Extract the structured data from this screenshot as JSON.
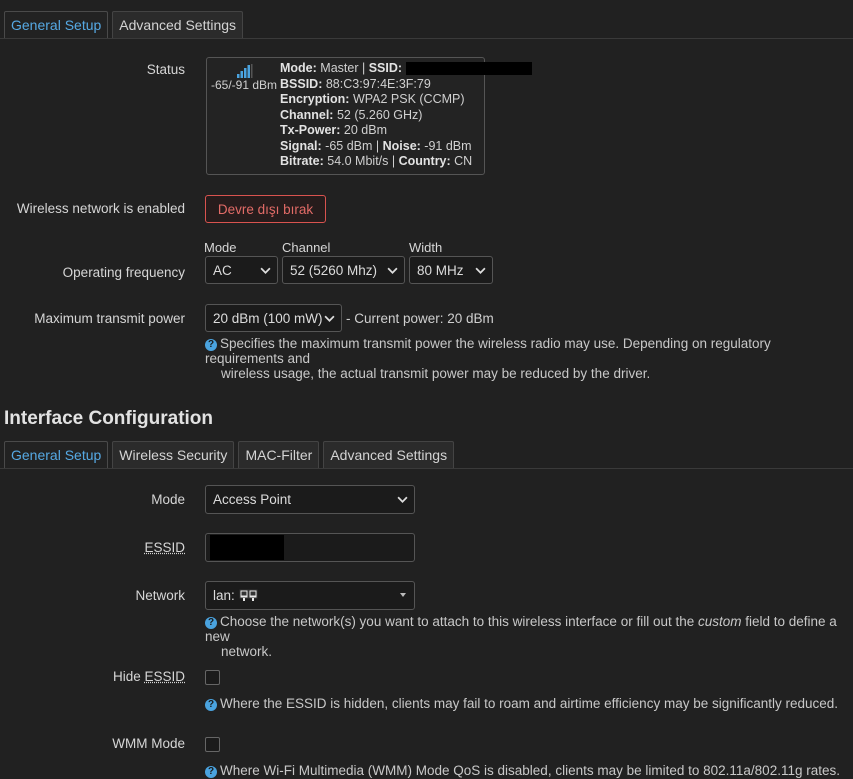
{
  "top_tabs": [
    {
      "label": "General Setup",
      "active": true
    },
    {
      "label": "Advanced Settings",
      "active": false
    }
  ],
  "status": {
    "label": "Status",
    "signal_range": "-65/-91 dBm",
    "mode_label": "Mode:",
    "mode_value": "Master",
    "ssid_label": "SSID:",
    "bssid_label": "BSSID:",
    "bssid_value": "88:C3:97:4E:3F:79",
    "encryption_label": "Encryption:",
    "encryption_value": "WPA2 PSK (CCMP)",
    "channel_label": "Channel:",
    "channel_value": "52 (5.260 GHz)",
    "txpower_label": "Tx-Power:",
    "txpower_value": "20 dBm",
    "signal_label": "Signal:",
    "signal_value": "-65 dBm",
    "noise_label": "Noise:",
    "noise_value": "-91 dBm",
    "bitrate_label": "Bitrate:",
    "bitrate_value": "54.0 Mbit/s",
    "country_label": "Country:",
    "country_value": "CN",
    "signal_bars_filled": 4
  },
  "wireless_enabled": {
    "label": "Wireless network is enabled",
    "button_label": "Devre dışı bırak"
  },
  "operating_frequency": {
    "label": "Operating frequency",
    "mode_label": "Mode",
    "mode_value": "AC",
    "channel_label": "Channel",
    "channel_value": "52 (5260 Mhz)",
    "width_label": "Width",
    "width_value": "80 MHz"
  },
  "tx_power": {
    "label": "Maximum transmit power",
    "value": "20 dBm (100 mW)",
    "current": "- Current power: 20 dBm",
    "help_line1": "Specifies the maximum transmit power the wireless radio may use. Depending on regulatory requirements and",
    "help_line2": "wireless usage, the actual transmit power may be reduced by the driver."
  },
  "interface_config": {
    "heading": "Interface Configuration",
    "tabs": [
      {
        "label": "General Setup",
        "active": true
      },
      {
        "label": "Wireless Security",
        "active": false
      },
      {
        "label": "MAC-Filter",
        "active": false
      },
      {
        "label": "Advanced Settings",
        "active": false
      }
    ],
    "mode_label": "Mode",
    "mode_value": "Access Point",
    "essid_label": "ESSID",
    "network_label": "Network",
    "network_value": "lan:",
    "network_help_pre": "Choose the network(s) you want to attach to this wireless interface or fill out the ",
    "network_help_em": "custom",
    "network_help_post": " field to define a new",
    "network_help_line2": "network.",
    "hide_essid_label_pre": "Hide ",
    "hide_essid_label_u": "ESSID",
    "hide_essid_help": "Where the ESSID is hidden, clients may fail to roam and airtime efficiency may be significantly reduced.",
    "wmm_label": "WMM Mode",
    "wmm_help": "Where Wi-Fi Multimedia (WMM) Mode QoS is disabled, clients may be limited to 802.11a/802.11g rates."
  },
  "colors": {
    "accent": "#56a9e4",
    "danger": "#d9534f",
    "background": "#212121"
  }
}
